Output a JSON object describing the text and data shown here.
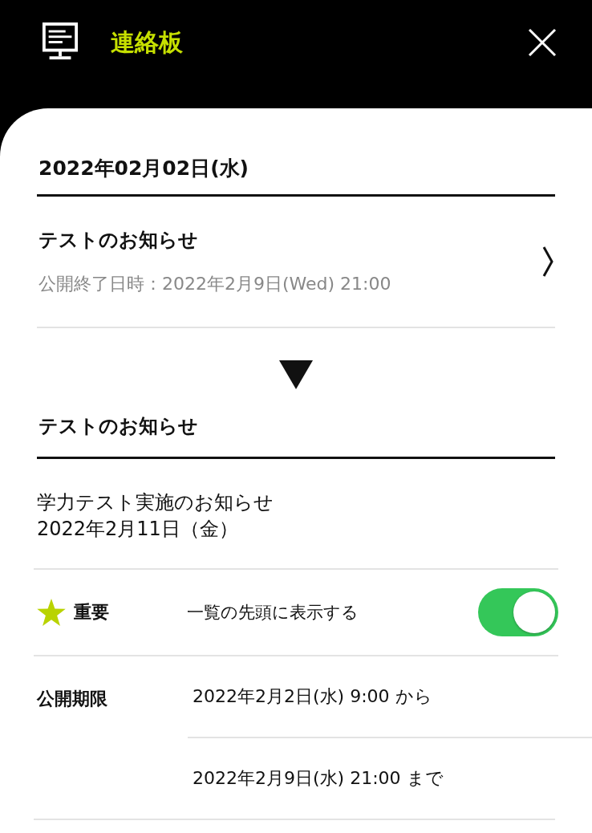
{
  "header": {
    "title": "連絡板"
  },
  "date_heading": "2022年02月02日(水)",
  "notices": [
    {
      "title": "テストのお知らせ",
      "subtitle": "公開終了日時：2022年2月9日(Wed) 21:00"
    }
  ],
  "detail": {
    "title": "テストのお知らせ",
    "body": [
      "学力テスト実施のお知らせ",
      "2022年2月11日（金）"
    ],
    "important": {
      "label": "重要",
      "text": "一覧の先頭に表示する",
      "on": true
    },
    "period": {
      "label": "公開期限",
      "lines": [
        "2022年2月2日(水) 9:00 から",
        "2022年2月9日(水) 21:00 まで"
      ]
    }
  }
}
